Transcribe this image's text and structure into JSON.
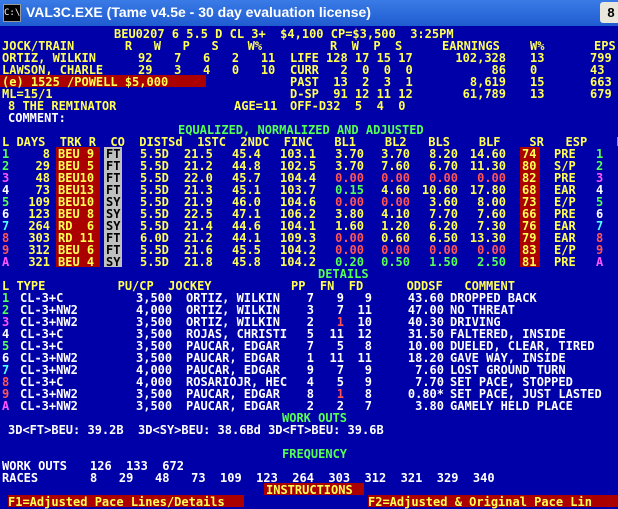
{
  "window": {
    "title": "VAL3C.EXE (Tame v4.5e - 30 day evaluation license)",
    "close_label": "8"
  },
  "header": {
    "race_line": "BEU0207 6 5.5 D CL 3+  $4,100 CP=$3,500  3:25PM",
    "col_labels": "JOCK/TRAIN       R   W   P   S    W%",
    "jockey": "ORTIZ, WILKIN",
    "jockey_stats": "92   7   6   2   11",
    "trainer": "LAWSON, CHARLE",
    "trainer_stats": "29   3   4   0   10",
    "owner_line": "(e) 1525 /POWELL $5,000",
    "ml": "ML=15/1",
    "horse": "8 THE REMINATOR",
    "age": "AGE=11",
    "comment_label": "COMMENT:",
    "rec_col_labels": "R  W  P  S",
    "earn_label": "EARNINGS",
    "wpct_label": "W%",
    "eps_label": "EPS",
    "records": [
      {
        "label": "LIFE",
        "stats": "128 17 15 17",
        "earn": "102,328",
        "wpct": "13",
        "eps": "799"
      },
      {
        "label": "CURR",
        "stats": "  2  0  0  0",
        "earn": "86",
        "wpct": "0",
        "eps": "43"
      },
      {
        "label": "PAST",
        "stats": " 13  2  3  1",
        "earn": "8,619",
        "wpct": "15",
        "eps": "663"
      },
      {
        "label": "D-SP",
        "stats": " 91 12 11 12",
        "earn": "61,789",
        "wpct": "13",
        "eps": "679"
      },
      {
        "label": "OFF-D",
        "stats": "32  5  4  0",
        "earn": "",
        "wpct": "",
        "eps": ""
      }
    ]
  },
  "adjusted": {
    "title": "EQUALIZED, NORMALIZED AND ADJUSTED",
    "headers": "L DAYS  TRK R  CO  DISTSd  1STC  2NDC  FINC   BL1    BL2   BLS    BLF    SR   ESP    L P",
    "rows": [
      {
        "l": "1",
        "days": "8",
        "trk": "BEU 9",
        "r": "FT",
        "co": "",
        "dist": "5.5D",
        "c1": "21.5",
        "c2": "45.4",
        "fin": "103.1",
        "bl1": "3.70",
        "bl2": "3.70",
        "bls": "8.20",
        "blf": "14.60",
        "sr": "74",
        "esp": "PRE",
        "lp": "1"
      },
      {
        "l": "2",
        "days": "29",
        "trk": "BEU 5",
        "r": "FT",
        "co": "",
        "dist": "5.5D",
        "c1": "21.2",
        "c2": "44.8",
        "fin": "102.5",
        "bl1": "3.70",
        "bl2": "7.60",
        "bls": "6.70",
        "blf": "11.30",
        "sr": "80",
        "esp": "S/P",
        "lp": "2"
      },
      {
        "l": "3",
        "days": "48",
        "trk": "BEU10",
        "r": "FT",
        "co": "",
        "dist": "5.5D",
        "c1": "22.0",
        "c2": "45.7",
        "fin": "104.4",
        "bl1": "0.00",
        "bl2": "0.00",
        "bls": "0.00",
        "blf": "0.00",
        "sr": "82",
        "esp": "PRE",
        "lp": "3"
      },
      {
        "l": "4",
        "days": "73",
        "trk": "BEU13",
        "r": "FT",
        "co": "",
        "dist": "5.5D",
        "c1": "21.3",
        "c2": "45.1",
        "fin": "103.7",
        "bl1": "0.15",
        "bl2": "4.60",
        "bls": "10.60",
        "blf": "17.80",
        "sr": "68",
        "esp": "EAR",
        "lp": "4"
      },
      {
        "l": "5",
        "days": "109",
        "trk": "BEU10",
        "r": "SY",
        "co": "",
        "dist": "5.5D",
        "c1": "21.9",
        "c2": "46.0",
        "fin": "104.6",
        "bl1": "0.00",
        "bl2": "0.00",
        "bls": "3.60",
        "blf": "8.00",
        "sr": "73",
        "esp": "E/P",
        "lp": "5"
      },
      {
        "l": "6",
        "days": "123",
        "trk": "BEU 8",
        "r": "SY",
        "co": "",
        "dist": "5.5D",
        "c1": "22.5",
        "c2": "47.1",
        "fin": "106.2",
        "bl1": "3.80",
        "bl2": "4.10",
        "bls": "7.70",
        "blf": "7.60",
        "sr": "66",
        "esp": "PRE",
        "lp": "6"
      },
      {
        "l": "7",
        "days": "264",
        "trk": "RD  6",
        "r": "SY",
        "co": "",
        "dist": "5.5D",
        "c1": "21.4",
        "c2": "44.6",
        "fin": "104.1",
        "bl1": "1.60",
        "bl2": "1.20",
        "bls": "6.20",
        "blf": "7.30",
        "sr": "76",
        "esp": "EAR",
        "lp": "7"
      },
      {
        "l": "8",
        "days": "303",
        "trk": "RD 11",
        "r": "FT",
        "co": "",
        "dist": "6.0D",
        "c1": "21.2",
        "c2": "44.1",
        "fin": "109.3",
        "bl1": "0.00",
        "bl2": "0.60",
        "bls": "6.50",
        "blf": "13.30",
        "sr": "79",
        "esp": "EAR",
        "lp": "8"
      },
      {
        "l": "9",
        "days": "312",
        "trk": "BEU 6",
        "r": "FT",
        "co": "",
        "dist": "5.5D",
        "c1": "21.6",
        "c2": "45.5",
        "fin": "104.2",
        "bl1": "0.00",
        "bl2": "0.00",
        "bls": "0.00",
        "blf": "0.00",
        "sr": "83",
        "esp": "E/P",
        "lp": "9"
      },
      {
        "l": "A",
        "days": "321",
        "trk": "BEU 4",
        "r": "SY",
        "co": "",
        "dist": "5.5D",
        "c1": "21.8",
        "c2": "45.8",
        "fin": "104.2",
        "bl1": "0.20",
        "bl2": "0.50",
        "bls": "1.50",
        "blf": "2.50",
        "sr": "81",
        "esp": "PRE",
        "lp": "A"
      }
    ]
  },
  "details": {
    "title": "DETAILS",
    "headers": "L TYPE          PU/CP  JOCKEY           PP  FN  FD      ODDSF   COMMENT",
    "rows": [
      {
        "l": "1",
        "type": "CL-3+C",
        "pucp": "3,500",
        "jockey": "ORTIZ, WILKIN",
        "pp": "7",
        "fn": "9",
        "fd": "9",
        "odds": "43.60",
        "comment": "DROPPED BACK"
      },
      {
        "l": "2",
        "type": "CL-3+NW2",
        "pucp": "4,000",
        "jockey": "ORTIZ, WILKIN",
        "pp": "3",
        "fn": "7",
        "fd": "11",
        "odds": "47.00",
        "comment": "NO THREAT"
      },
      {
        "l": "3",
        "type": "CL-3+NW2",
        "pucp": "3,500",
        "jockey": "ORTIZ, WILKIN",
        "pp": "2",
        "fn": "1",
        "fd": "10",
        "odds": "40.30",
        "comment": "DRIVING"
      },
      {
        "l": "4",
        "type": "CL-3+C",
        "pucp": "3,500",
        "jockey": "ROJAS, CHRISTI",
        "pp": "5",
        "fn": "11",
        "fd": "12",
        "odds": "31.50",
        "comment": "FALTERED, INSIDE"
      },
      {
        "l": "5",
        "type": "CL-3+C",
        "pucp": "3,500",
        "jockey": "PAUCAR, EDGAR",
        "pp": "7",
        "fn": "5",
        "fd": "8",
        "odds": "10.00",
        "comment": "DUELED, CLEAR, TIRED"
      },
      {
        "l": "6",
        "type": "CL-3+NW2",
        "pucp": "3,500",
        "jockey": "PAUCAR, EDGAR",
        "pp": "1",
        "fn": "11",
        "fd": "11",
        "odds": "18.20",
        "comment": "GAVE WAY, INSIDE"
      },
      {
        "l": "7",
        "type": "CL-3+NW2",
        "pucp": "4,000",
        "jockey": "PAUCAR, EDGAR",
        "pp": "9",
        "fn": "7",
        "fd": "9",
        "odds": "7.60",
        "comment": "LOST GROUND TURN"
      },
      {
        "l": "8",
        "type": "CL-3+C",
        "pucp": "4,000",
        "jockey": "ROSARIOJR, HEC",
        "pp": "4",
        "fn": "5",
        "fd": "9",
        "odds": "7.70",
        "comment": "SET PACE, STOPPED"
      },
      {
        "l": "9",
        "type": "CL-3+NW2",
        "pucp": "3,500",
        "jockey": "PAUCAR, EDGAR",
        "pp": "8",
        "fn": "1",
        "fd": "8",
        "odds": "0.80*",
        "comment": "SET PACE, JUST LASTED"
      },
      {
        "l": "A",
        "type": "CL-3+NW2",
        "pucp": "3,500",
        "jockey": "PAUCAR, EDGAR",
        "pp": "2",
        "fn": "2",
        "fd": "7",
        "odds": "3.80",
        "comment": "GAMELY HELD PLACE"
      }
    ]
  },
  "workouts": {
    "title": "WORK OUTS",
    "line": "3D<FT>BEU: 39.2B  3D<SY>BEU: 38.6Bd 3D<FT>BEU: 39.6B"
  },
  "frequency": {
    "title": "FREQUENCY",
    "work_label": "WORK OUTS",
    "work_values": "126  133  672",
    "races_label": "RACES",
    "races_values": "8   29   48   73  109  123  264  303  312  321  329  340"
  },
  "instructions": {
    "title": "INSTRUCTIONS",
    "f1": "F1=Adjusted Pace Lines/Details",
    "f2": "F2=Adjusted & Original Pace Lin"
  },
  "colors": {
    "background": "#0000a8",
    "yellow": "#ffff55",
    "cyan": "#55ffff",
    "green": "#55ff55",
    "red_bar": "#aa0000",
    "gray_bar": "#c0c0c0"
  }
}
